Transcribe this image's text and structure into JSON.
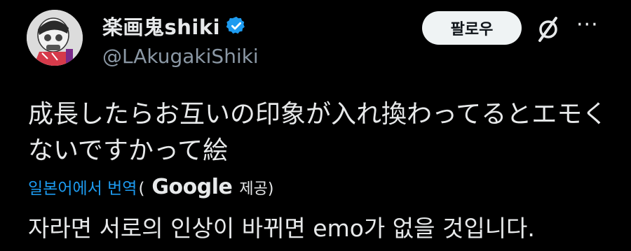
{
  "author": {
    "display_name": "楽画鬼shiki",
    "handle": "@LAkugakiShiki",
    "verified": true,
    "verified_color": "#1d9bf0"
  },
  "actions": {
    "follow_label": "팔로우",
    "grok_icon": "grok-icon",
    "more_label": "···"
  },
  "tweet": {
    "text": "成長したらお互いの印象が入れ換わってるとエモくないですかって絵"
  },
  "translation": {
    "link_label": "일본어에서 번역",
    "open_paren": "(",
    "provider": "Google",
    "provided_label": "제공)",
    "text": "자라면 서로의 인상이 바뀌면 emo가 없을 것입니다."
  },
  "colors": {
    "background": "#000000",
    "text": "#e7e9ea",
    "secondary": "#8b98a5",
    "link": "#1d9bf0",
    "button_bg": "#eff3f4"
  }
}
